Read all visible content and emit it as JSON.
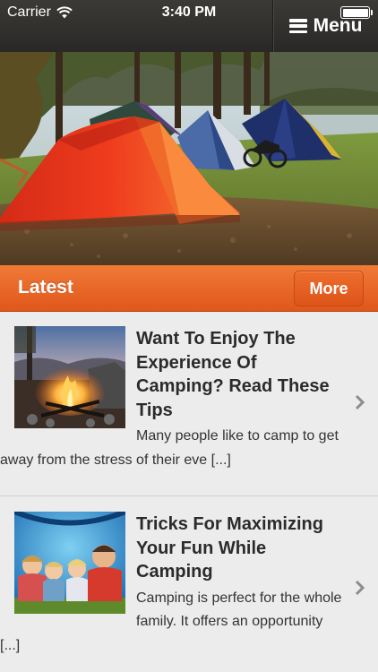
{
  "status": {
    "carrier": "Carrier",
    "time": "3:40 PM"
  },
  "nav": {
    "menu_label": "Menu"
  },
  "section": {
    "title": "Latest",
    "more_label": "More"
  },
  "articles": [
    {
      "title": "Want To Enjoy The Experience Of Camping? Read These Tips",
      "excerpt": "Many people like to camp to get away from the stress of their eve [...]"
    },
    {
      "title": "Tricks For Maximizing Your Fun While Camping",
      "excerpt": "Camping is perfect for the whole family. It offers an opportunity [...]"
    }
  ],
  "colors": {
    "accent": "#e8642a",
    "topbar": "#2f2d2b",
    "background": "#ececec"
  },
  "icons": {
    "menu": "hamburger-icon",
    "row_arrow": "chevron-right-icon",
    "wifi": "wifi-icon",
    "battery": "battery-icon"
  }
}
